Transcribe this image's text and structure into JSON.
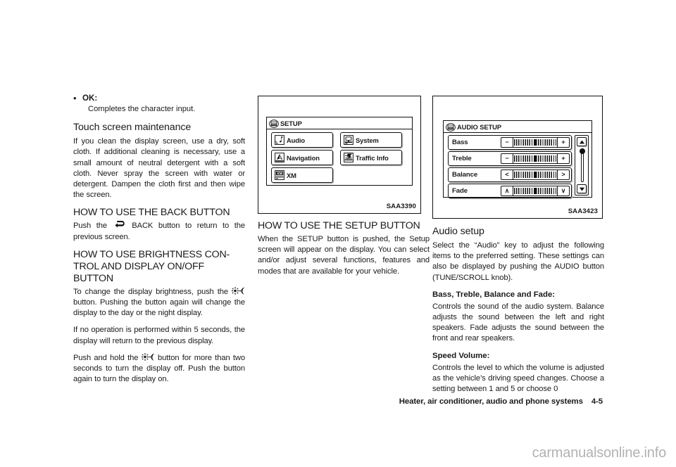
{
  "document": {
    "watermark": "carmanualsonline.info",
    "footer": {
      "section_title": "Heater, air conditioner, audio and phone systems",
      "page_number": "4-5"
    }
  },
  "column_left": {
    "bullet": {
      "marker": "•",
      "label": "OK:",
      "description": "Completes the character input."
    },
    "touch_screen": {
      "heading": "Touch screen maintenance",
      "paragraph": "If you clean the display screen, use a dry, soft cloth. If additional cleaning is necessary, use a small amount of neutral detergent with a soft cloth. Never spray the screen with water or detergent. Dampen the cloth first and then wipe the screen."
    },
    "back_button": {
      "heading": "HOW TO USE THE BACK BUTTON",
      "text_before_icon": "Push the",
      "icon": "back-arrow-icon",
      "text_after_icon": "BACK button to return to the previous screen."
    },
    "brightness": {
      "heading": "HOW TO USE BRIGHTNESS CON-TROL AND DISPLAY ON/OFF BUTTON",
      "heading_line1": "HOW TO USE BRIGHTNESS CON-",
      "heading_line2": "TROL AND DISPLAY ON/OFF BUTTON",
      "para1_before": "To change the display brightness, push the",
      "para1_after": "button. Pushing the button again will change the display to the day or the night display.",
      "para2": "If no operation is performed within 5 seconds, the display will return to the previous display.",
      "para3_before": "Push and hold the",
      "para3_after": "button for more than two seconds to turn the display off. Push the button again to turn the display on."
    }
  },
  "column_middle": {
    "figure": {
      "caption": "SAA3390",
      "screen_title": "SETUP",
      "title_icon": "setup-hardkey-icon",
      "buttons": [
        {
          "label": "Audio",
          "icon": "audio-note-icon"
        },
        {
          "label": "System",
          "icon": "system-monitor-icon"
        },
        {
          "label": "Navigation",
          "icon": "navigation-arrow-icon"
        },
        {
          "label": "Traffic Info",
          "icon": "traffic-info-icon"
        },
        {
          "label": "XM",
          "icon": "xm-icon"
        }
      ]
    },
    "setup_button": {
      "heading": "HOW TO USE THE SETUP BUTTON",
      "paragraph": "When the SETUP button is pushed, the Setup screen will appear on the display. You can select and/or adjust several functions, features and modes that are available for your vehicle."
    }
  },
  "column_right": {
    "figure": {
      "caption": "SAA3423",
      "screen_title": "AUDIO SETUP",
      "title_icon": "setup-hardkey-icon",
      "rows": [
        {
          "label": "Bass",
          "minus": "−",
          "plus": "+"
        },
        {
          "label": "Treble",
          "minus": "−",
          "plus": "+"
        },
        {
          "label": "Balance",
          "minus": "<",
          "plus": ">"
        },
        {
          "label": "Fade",
          "minus": "∧",
          "plus": "∨"
        }
      ],
      "scroll_up": "▲",
      "scroll_down": "▼"
    },
    "audio_setup": {
      "heading": "Audio setup",
      "paragraph": "Select the “Audio” key to adjust the following items to the preferred setting. These settings can also be displayed by pushing the AUDIO button (TUNE/SCROLL knob).",
      "sub1_heading": "Bass, Treble, Balance and Fade:",
      "sub1_text": "Controls the sound of the audio system. Balance adjusts the sound between the left and right speakers. Fade adjusts the sound between the front and rear speakers.",
      "sub2_heading": "Speed Volume:",
      "sub2_text": "Controls the level to which the volume is adjusted as the vehicle’s driving speed changes. Choose a setting between 1 and 5 or choose 0"
    }
  }
}
